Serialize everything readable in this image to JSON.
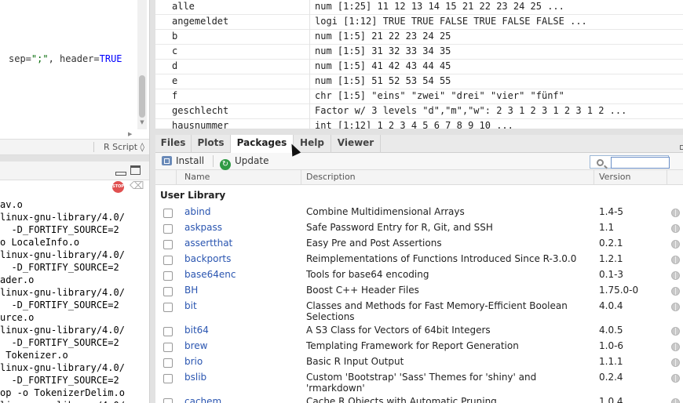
{
  "editor": {
    "code_lines": [
      {
        "parts": [
          {
            "text": "sep=",
            "kind": "plain"
          },
          {
            "text": "\";\"",
            "kind": "str"
          },
          {
            "text": ", header=",
            "kind": "plain"
          },
          {
            "text": "TRUE",
            "kind": "kw"
          }
        ]
      }
    ],
    "filetype": "R Script ◊"
  },
  "console": {
    "lines": [
      "av.o",
      "linux-gnu-library/4.0/",
      "  -D_FORTIFY_SOURCE=2",
      "o LocaleInfo.o",
      "linux-gnu-library/4.0/",
      "  -D_FORTIFY_SOURCE=2",
      "ader.o",
      "linux-gnu-library/4.0/",
      "  -D_FORTIFY_SOURCE=2",
      "urce.o",
      "linux-gnu-library/4.0/",
      "  -D_FORTIFY_SOURCE=2",
      " Tokenizer.o",
      "linux-gnu-library/4.0/",
      "  -D_FORTIFY_SOURCE=2",
      "op -o TokenizerDelim.o",
      "linux-gnu-library/4.0/"
    ],
    "stop_icon_text": "STOP"
  },
  "environment": {
    "rows": [
      {
        "name": "alle",
        "value": "num [1:25] 11 12 13 14 15 21 22 23 24 25 ..."
      },
      {
        "name": "angemeldet",
        "value": "logi [1:12] TRUE TRUE FALSE TRUE FALSE FALSE ..."
      },
      {
        "name": "b",
        "value": "num [1:5] 21 22 23 24 25"
      },
      {
        "name": "c",
        "value": "num [1:5] 31 32 33 34 35"
      },
      {
        "name": "d",
        "value": "num [1:5] 41 42 43 44 45"
      },
      {
        "name": "e",
        "value": "num [1:5] 51 52 53 54 55"
      },
      {
        "name": "f",
        "value": "chr [1:5] \"eins\" \"zwei\" \"drei\" \"vier\" \"fünf\""
      },
      {
        "name": "geschlecht",
        "value": "Factor w/ 3 levels \"d\",\"m\",\"w\": 2 3 1 2 3 1 2 3 1 2 ..."
      },
      {
        "name": "hausnummer",
        "value": "int [1:12] 1 2 3 4 5 6 7 8 9 10 ..."
      }
    ]
  },
  "tabs": [
    {
      "label": "Files",
      "active": false
    },
    {
      "label": "Plots",
      "active": false
    },
    {
      "label": "Packages",
      "active": true
    },
    {
      "label": "Help",
      "active": false
    },
    {
      "label": "Viewer",
      "active": false
    }
  ],
  "toolbar": {
    "install_label": "Install",
    "update_label": "Update",
    "update_icon": "↻",
    "search_value": ""
  },
  "columns": {
    "name": "Name",
    "description": "Description",
    "version": "Version"
  },
  "library_heading": "User Library",
  "packages": [
    {
      "name": "abind",
      "description": "Combine Multidimensional Arrays",
      "version": "1.4-5"
    },
    {
      "name": "askpass",
      "description": "Safe Password Entry for R, Git, and SSH",
      "version": "1.1"
    },
    {
      "name": "assertthat",
      "description": "Easy Pre and Post Assertions",
      "version": "0.2.1"
    },
    {
      "name": "backports",
      "description": "Reimplementations of Functions Introduced Since R-3.0.0",
      "version": "1.2.1"
    },
    {
      "name": "base64enc",
      "description": "Tools for base64 encoding",
      "version": "0.1-3"
    },
    {
      "name": "BH",
      "description": "Boost C++ Header Files",
      "version": "1.75.0-0"
    },
    {
      "name": "bit",
      "description": "Classes and Methods for Fast Memory-Efficient Boolean Selections",
      "version": "4.0.4"
    },
    {
      "name": "bit64",
      "description": "A S3 Class for Vectors of 64bit Integers",
      "version": "4.0.5"
    },
    {
      "name": "brew",
      "description": "Templating Framework for Report Generation",
      "version": "1.0-6"
    },
    {
      "name": "brio",
      "description": "Basic R Input Output",
      "version": "1.1.1"
    },
    {
      "name": "bslib",
      "description": "Custom 'Bootstrap' 'Sass' Themes for 'shiny' and 'rmarkdown'",
      "version": "0.2.4"
    },
    {
      "name": "cachem",
      "description": "Cache R Objects with Automatic Pruning",
      "version": "1.0.4"
    }
  ],
  "colors": {
    "package_link": "#2a55b0",
    "string_token": "#036a07",
    "keyword_token": "#0000ff"
  }
}
